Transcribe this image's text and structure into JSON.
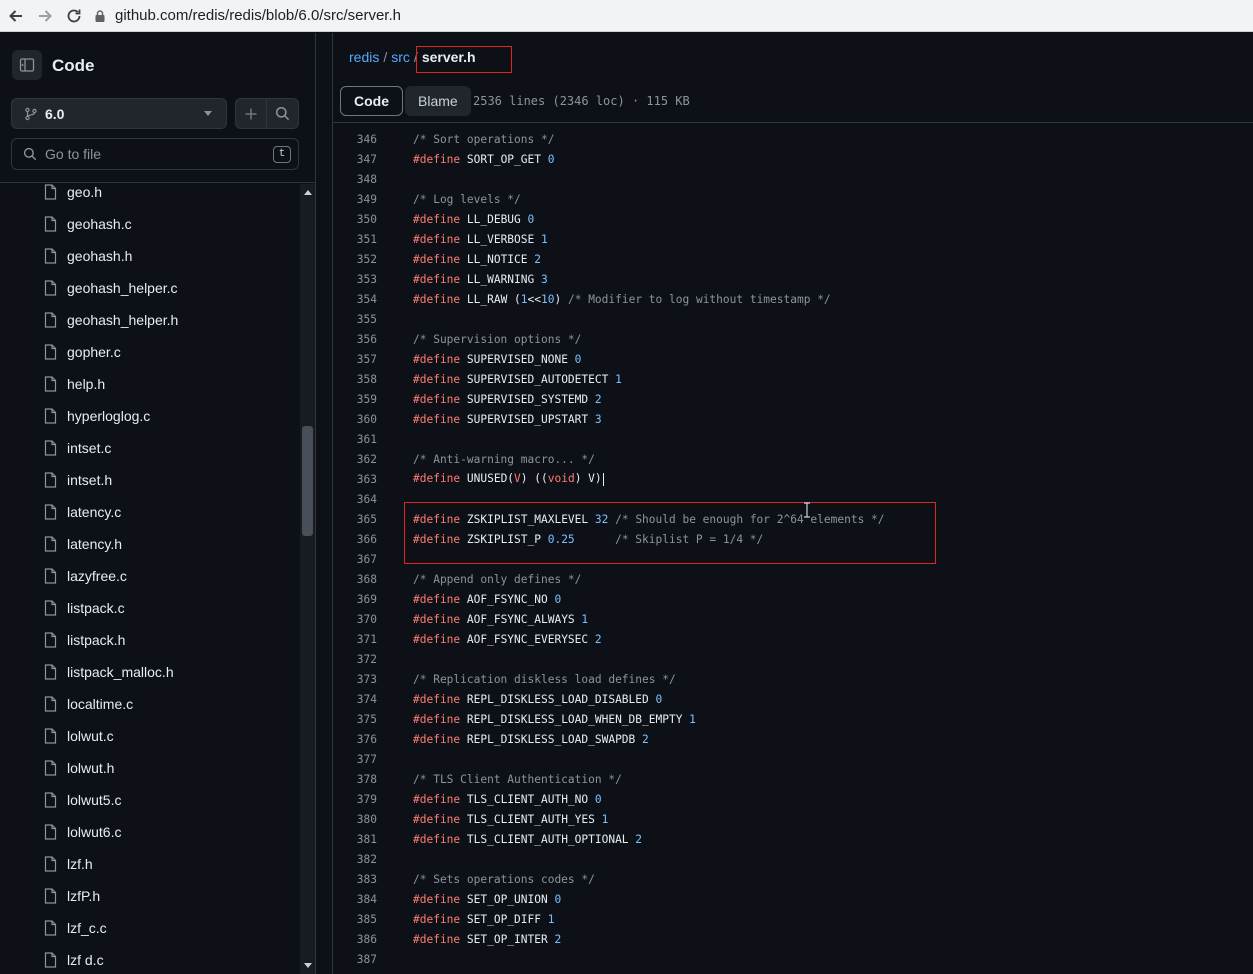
{
  "browser": {
    "url": "github.com/redis/redis/blob/6.0/src/server.h"
  },
  "sidebar": {
    "title": "Code",
    "branch": "6.0",
    "search_placeholder": "Go to file",
    "search_shortcut": "t",
    "files": [
      "geo.h",
      "geohash.c",
      "geohash.h",
      "geohash_helper.c",
      "geohash_helper.h",
      "gopher.c",
      "help.h",
      "hyperloglog.c",
      "intset.c",
      "intset.h",
      "latency.c",
      "latency.h",
      "lazyfree.c",
      "listpack.c",
      "listpack.h",
      "listpack_malloc.h",
      "localtime.c",
      "lolwut.c",
      "lolwut.h",
      "lolwut5.c",
      "lolwut6.c",
      "lzf.h",
      "lzfP.h",
      "lzf_c.c",
      "lzf d.c"
    ]
  },
  "breadcrumb": {
    "repo": "redis",
    "sep": "/",
    "dir": "src",
    "file": "server.h"
  },
  "codeview": {
    "tab_code": "Code",
    "tab_blame": "Blame",
    "file_info": "2536 lines (2346 loc) · 115 KB"
  },
  "code_lines": [
    {
      "n": "346",
      "t": [
        [
          "cm",
          "/* Sort operations */"
        ]
      ]
    },
    {
      "n": "347",
      "t": [
        [
          "kw",
          "#define"
        ],
        [
          "pl",
          " SORT_OP_GET "
        ],
        [
          "nm",
          "0"
        ]
      ]
    },
    {
      "n": "348",
      "t": []
    },
    {
      "n": "349",
      "t": [
        [
          "cm",
          "/* Log levels */"
        ]
      ]
    },
    {
      "n": "350",
      "t": [
        [
          "kw",
          "#define"
        ],
        [
          "pl",
          " LL_DEBUG "
        ],
        [
          "nm",
          "0"
        ]
      ]
    },
    {
      "n": "351",
      "t": [
        [
          "kw",
          "#define"
        ],
        [
          "pl",
          " LL_VERBOSE "
        ],
        [
          "nm",
          "1"
        ]
      ]
    },
    {
      "n": "352",
      "t": [
        [
          "kw",
          "#define"
        ],
        [
          "pl",
          " LL_NOTICE "
        ],
        [
          "nm",
          "2"
        ]
      ]
    },
    {
      "n": "353",
      "t": [
        [
          "kw",
          "#define"
        ],
        [
          "pl",
          " LL_WARNING "
        ],
        [
          "nm",
          "3"
        ]
      ]
    },
    {
      "n": "354",
      "t": [
        [
          "kw",
          "#define"
        ],
        [
          "pl",
          " LL_RAW ("
        ],
        [
          "nm",
          "1"
        ],
        [
          "pl",
          "<<"
        ],
        [
          "nm",
          "10"
        ],
        [
          "pl",
          ") "
        ],
        [
          "cm",
          "/* Modifier to log without timestamp */"
        ]
      ]
    },
    {
      "n": "355",
      "t": []
    },
    {
      "n": "356",
      "t": [
        [
          "cm",
          "/* Supervision options */"
        ]
      ]
    },
    {
      "n": "357",
      "t": [
        [
          "kw",
          "#define"
        ],
        [
          "pl",
          " SUPERVISED_NONE "
        ],
        [
          "nm",
          "0"
        ]
      ]
    },
    {
      "n": "358",
      "t": [
        [
          "kw",
          "#define"
        ],
        [
          "pl",
          " SUPERVISED_AUTODETECT "
        ],
        [
          "nm",
          "1"
        ]
      ]
    },
    {
      "n": "359",
      "t": [
        [
          "kw",
          "#define"
        ],
        [
          "pl",
          " SUPERVISED_SYSTEMD "
        ],
        [
          "nm",
          "2"
        ]
      ]
    },
    {
      "n": "360",
      "t": [
        [
          "kw",
          "#define"
        ],
        [
          "pl",
          " SUPERVISED_UPSTART "
        ],
        [
          "nm",
          "3"
        ]
      ]
    },
    {
      "n": "361",
      "t": []
    },
    {
      "n": "362",
      "t": [
        [
          "cm",
          "/* Anti-warning macro... */"
        ]
      ]
    },
    {
      "n": "363",
      "t": [
        [
          "kw",
          "#define"
        ],
        [
          "pl",
          " UNUSED("
        ],
        [
          "kw",
          "V"
        ],
        [
          "pl",
          ") (("
        ],
        [
          "kw",
          "void"
        ],
        [
          "pl",
          ") V)"
        ]
      ]
    },
    {
      "n": "364",
      "t": []
    },
    {
      "n": "365",
      "t": [
        [
          "kw",
          "#define"
        ],
        [
          "pl",
          " ZSKIPLIST_MAXLEVEL "
        ],
        [
          "nm",
          "32"
        ],
        [
          "pl",
          " "
        ],
        [
          "cm",
          "/* Should be enough for 2^64 elements */"
        ]
      ]
    },
    {
      "n": "366",
      "t": [
        [
          "kw",
          "#define"
        ],
        [
          "pl",
          " ZSKIPLIST_P "
        ],
        [
          "nm",
          "0.25"
        ],
        [
          "pl",
          "      "
        ],
        [
          "cm",
          "/* Skiplist P = 1/4 */"
        ]
      ]
    },
    {
      "n": "367",
      "t": []
    },
    {
      "n": "368",
      "t": [
        [
          "cm",
          "/* Append only defines */"
        ]
      ]
    },
    {
      "n": "369",
      "t": [
        [
          "kw",
          "#define"
        ],
        [
          "pl",
          " AOF_FSYNC_NO "
        ],
        [
          "nm",
          "0"
        ]
      ]
    },
    {
      "n": "370",
      "t": [
        [
          "kw",
          "#define"
        ],
        [
          "pl",
          " AOF_FSYNC_ALWAYS "
        ],
        [
          "nm",
          "1"
        ]
      ]
    },
    {
      "n": "371",
      "t": [
        [
          "kw",
          "#define"
        ],
        [
          "pl",
          " AOF_FSYNC_EVERYSEC "
        ],
        [
          "nm",
          "2"
        ]
      ]
    },
    {
      "n": "372",
      "t": []
    },
    {
      "n": "373",
      "t": [
        [
          "cm",
          "/* Replication diskless load defines */"
        ]
      ]
    },
    {
      "n": "374",
      "t": [
        [
          "kw",
          "#define"
        ],
        [
          "pl",
          " REPL_DISKLESS_LOAD_DISABLED "
        ],
        [
          "nm",
          "0"
        ]
      ]
    },
    {
      "n": "375",
      "t": [
        [
          "kw",
          "#define"
        ],
        [
          "pl",
          " REPL_DISKLESS_LOAD_WHEN_DB_EMPTY "
        ],
        [
          "nm",
          "1"
        ]
      ]
    },
    {
      "n": "376",
      "t": [
        [
          "kw",
          "#define"
        ],
        [
          "pl",
          " REPL_DISKLESS_LOAD_SWAPDB "
        ],
        [
          "nm",
          "2"
        ]
      ]
    },
    {
      "n": "377",
      "t": []
    },
    {
      "n": "378",
      "t": [
        [
          "cm",
          "/* TLS Client Authentication */"
        ]
      ]
    },
    {
      "n": "379",
      "t": [
        [
          "kw",
          "#define"
        ],
        [
          "pl",
          " TLS_CLIENT_AUTH_NO "
        ],
        [
          "nm",
          "0"
        ]
      ]
    },
    {
      "n": "380",
      "t": [
        [
          "kw",
          "#define"
        ],
        [
          "pl",
          " TLS_CLIENT_AUTH_YES "
        ],
        [
          "nm",
          "1"
        ]
      ]
    },
    {
      "n": "381",
      "t": [
        [
          "kw",
          "#define"
        ],
        [
          "pl",
          " TLS_CLIENT_AUTH_OPTIONAL "
        ],
        [
          "nm",
          "2"
        ]
      ]
    },
    {
      "n": "382",
      "t": []
    },
    {
      "n": "383",
      "t": [
        [
          "cm",
          "/* Sets operations codes */"
        ]
      ]
    },
    {
      "n": "384",
      "t": [
        [
          "kw",
          "#define"
        ],
        [
          "pl",
          " SET_OP_UNION "
        ],
        [
          "nm",
          "0"
        ]
      ]
    },
    {
      "n": "385",
      "t": [
        [
          "kw",
          "#define"
        ],
        [
          "pl",
          " SET_OP_DIFF "
        ],
        [
          "nm",
          "1"
        ]
      ]
    },
    {
      "n": "386",
      "t": [
        [
          "kw",
          "#define"
        ],
        [
          "pl",
          " SET_OP_INTER "
        ],
        [
          "nm",
          "2"
        ]
      ]
    },
    {
      "n": "387",
      "t": []
    }
  ],
  "colors": {
    "background": "#0d1117",
    "link": "#58a6ff",
    "keyword": "#ff7b72",
    "number": "#79c0ff",
    "comment": "#8b949e",
    "annotation_box": "#e02424"
  },
  "icons": {
    "back": "arrow-left-icon",
    "forward": "arrow-right-icon",
    "reload": "reload-icon",
    "lock": "lock-icon",
    "sidebar_toggle": "sidebar-collapse-icon",
    "branch": "git-branch-icon",
    "add": "plus-icon",
    "search": "search-icon",
    "file": "file-icon"
  }
}
